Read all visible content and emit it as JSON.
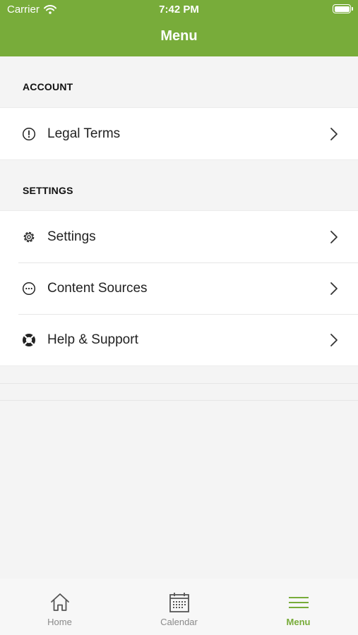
{
  "status_bar": {
    "carrier": "Carrier",
    "time": "7:42 PM"
  },
  "header": {
    "title": "Menu",
    "color": "#78ac3a"
  },
  "sections": [
    {
      "title": "ACCOUNT",
      "items": [
        {
          "label": "Legal Terms",
          "icon": "info-circle-icon"
        }
      ]
    },
    {
      "title": "SETTINGS",
      "items": [
        {
          "label": "Settings",
          "icon": "gear-icon"
        },
        {
          "label": "Content Sources",
          "icon": "ellipsis-circle-icon"
        },
        {
          "label": "Help & Support",
          "icon": "lifebuoy-icon"
        }
      ]
    }
  ],
  "tabbar": {
    "tabs": [
      {
        "label": "Home",
        "icon": "home-icon",
        "active": false
      },
      {
        "label": "Calendar",
        "icon": "calendar-icon",
        "active": false
      },
      {
        "label": "Menu",
        "icon": "hamburger-menu-icon",
        "active": true
      }
    ],
    "active_color": "#78ac3a",
    "inactive_color": "#8a8a8a"
  }
}
